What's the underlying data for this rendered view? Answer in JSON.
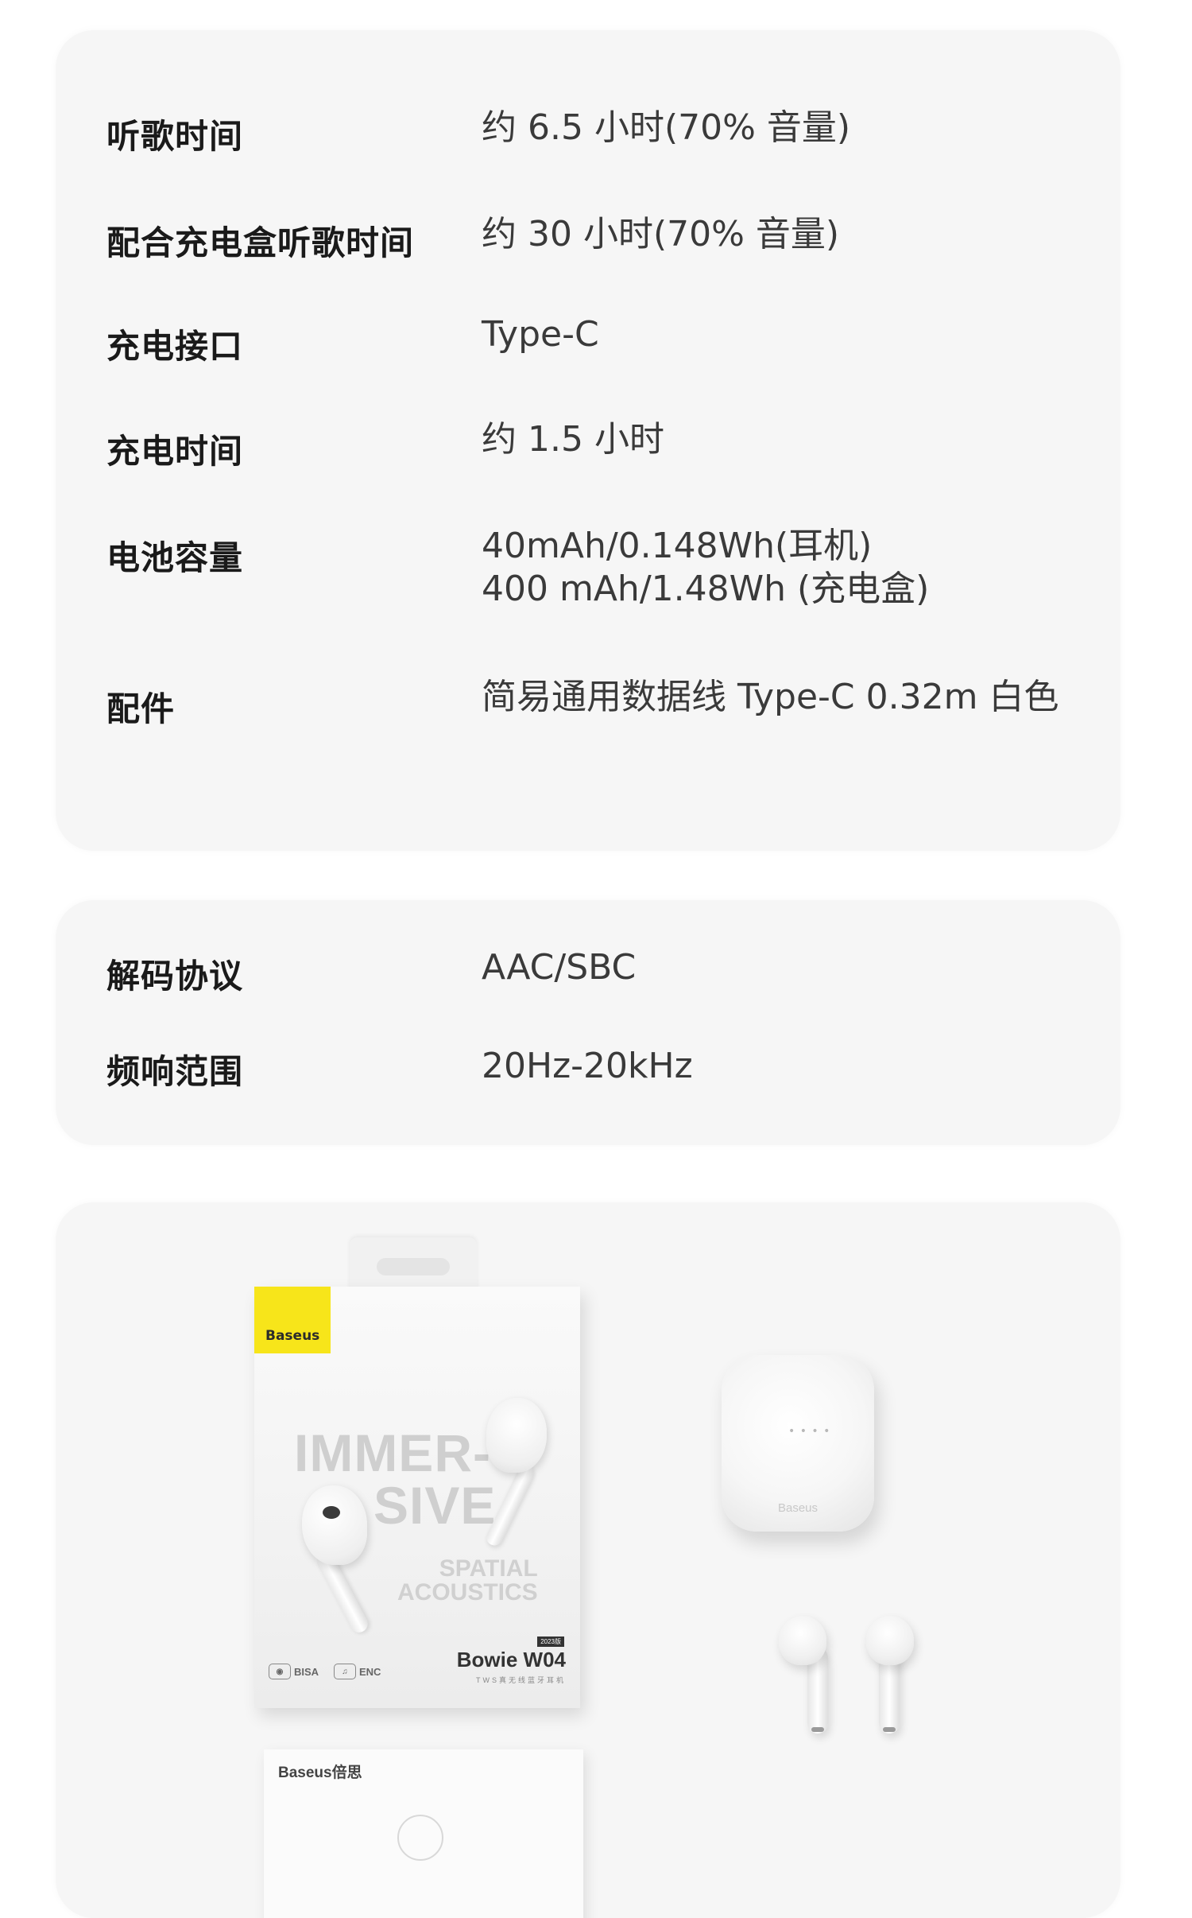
{
  "spec_group_1": {
    "rows": [
      {
        "label": "听歌时间",
        "value": [
          "约 6.5 小时(70% 音量)"
        ]
      },
      {
        "label": "配合充电盒听歌时间",
        "value": [
          "约 30 小时(70% 音量)"
        ]
      },
      {
        "label": "充电接口",
        "value": [
          "Type-C"
        ]
      },
      {
        "label": "充电时间",
        "value": [
          "约 1.5 小时"
        ]
      },
      {
        "label": "电池容量",
        "value": [
          "40mAh/0.148Wh(耳机)",
          "400 mAh/1.48Wh (充电盒)"
        ]
      },
      {
        "label": "配件",
        "value": [
          "简易通用数据线 Type-C 0.32m 白色"
        ]
      }
    ]
  },
  "spec_group_2": {
    "rows": [
      {
        "label": "解码协议",
        "value": [
          "AAC/SBC"
        ]
      },
      {
        "label": "频响范围",
        "value": [
          "20Hz-20kHz"
        ]
      }
    ]
  },
  "package_contents": {
    "box": {
      "brand": "Baseus",
      "headline_1": "IMMER-",
      "headline_2": "SIVE",
      "sub_1": "SPATIAL",
      "sub_2": "ACOUSTICS",
      "feature_1": "BISA",
      "feature_2": "ENC",
      "model": "Bowie W04",
      "year_tag": "2023版",
      "model_sub": "TWS真无线蓝牙耳机"
    },
    "case": {
      "logo": "Baseus",
      "dots": "• • • •"
    },
    "manual": {
      "brand": "Baseus倍思"
    }
  },
  "colors": {
    "card_bg": "#f6f6f6",
    "label_text": "#1a1a1a",
    "value_text": "#3a3a3a",
    "brand_yellow": "#f7e51a"
  }
}
